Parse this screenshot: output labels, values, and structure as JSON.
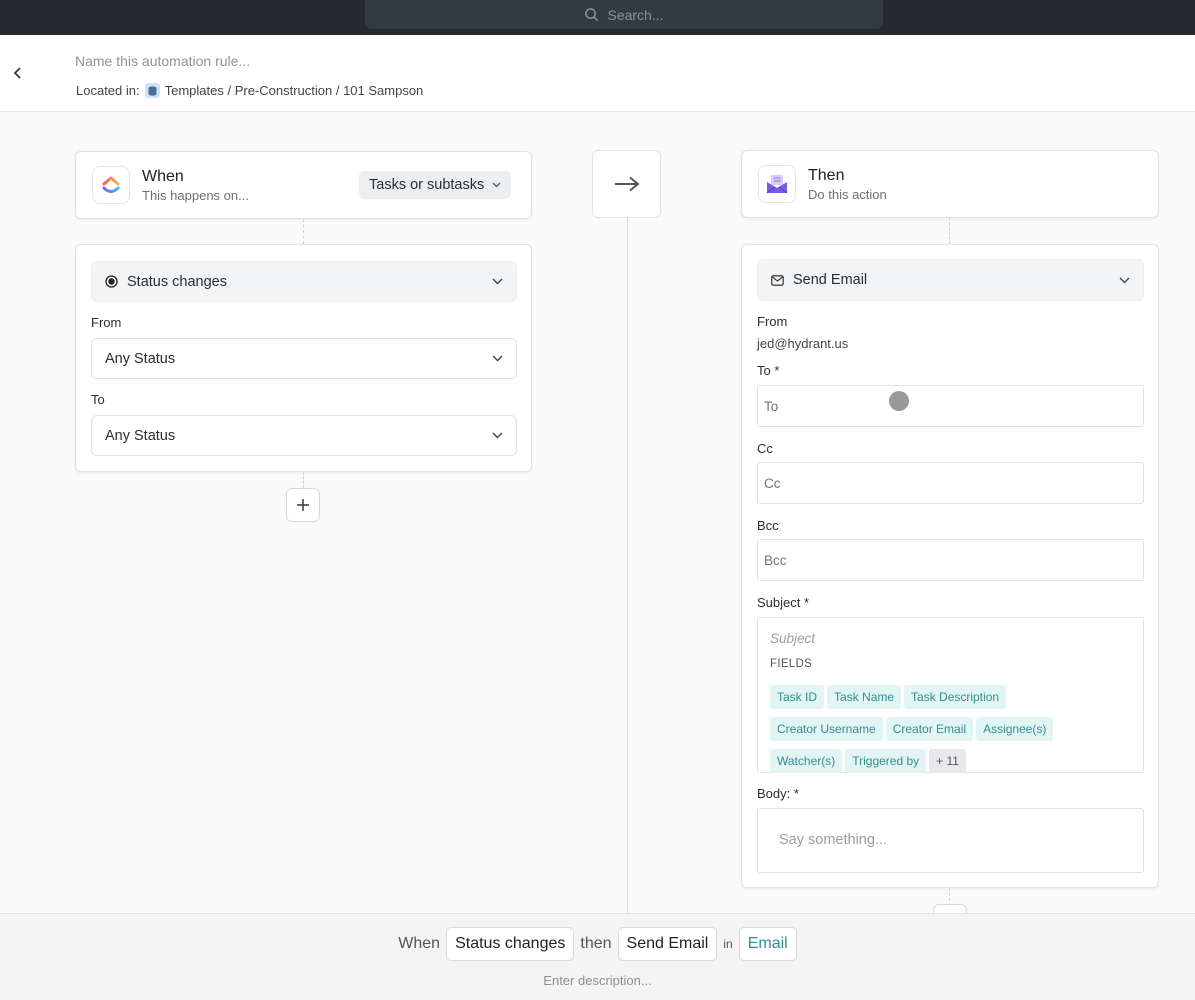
{
  "topbar": {
    "search_placeholder": "Search..."
  },
  "header": {
    "rule_name_placeholder": "Name this automation rule...",
    "located_label": "Located in:",
    "located_path": "Templates / Pre-Construction / 101 Sampson"
  },
  "trigger": {
    "title": "When",
    "subtitle": "This happens on...",
    "scope": "Tasks or subtasks",
    "event": "Status changes",
    "from_label": "From",
    "from_value": "Any Status",
    "to_label": "To",
    "to_value": "Any Status"
  },
  "action": {
    "title": "Then",
    "subtitle": "Do this action",
    "type": "Send Email",
    "from_label": "From",
    "from_value": "jed@hydrant.us",
    "to_label": "To",
    "to_placeholder": "To",
    "cc_label": "Cc",
    "cc_placeholder": "Cc",
    "bcc_label": "Bcc",
    "bcc_placeholder": "Bcc",
    "subject_label": "Subject",
    "subject_placeholder": "Subject",
    "fields_label": "FIELDS",
    "fields": [
      "Task ID",
      "Task Name",
      "Task Description",
      "Creator Username",
      "Creator Email",
      "Assignee(s)",
      "Watcher(s)",
      "Triggered by"
    ],
    "fields_more": "+ 11",
    "body_label": "Body:",
    "body_placeholder": "Say something...",
    "required_mark": "*"
  },
  "summary": {
    "when": "When",
    "trigger": "Status changes",
    "then": "then",
    "action": "Send Email",
    "in": "in",
    "target": "Email",
    "description_placeholder": "Enter description..."
  },
  "colors": {
    "accent_teal": "#2f8f92",
    "topbar": "#232a31"
  }
}
